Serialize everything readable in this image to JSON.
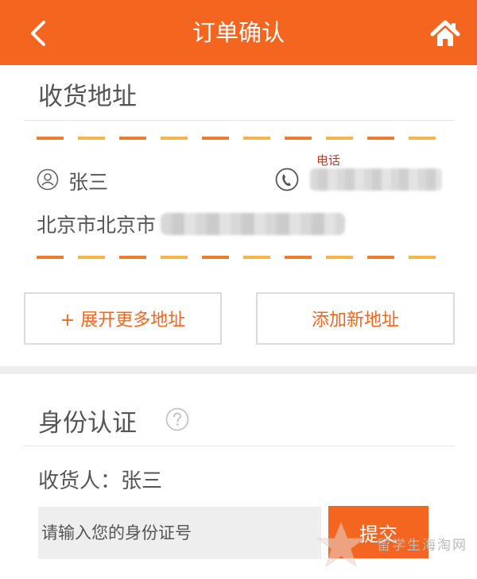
{
  "header": {
    "title": "订单确认",
    "back_icon": "chevron-left-icon",
    "home_icon": "home-icon",
    "background": "#f46620"
  },
  "address_section": {
    "title": "收货地址",
    "recipient": {
      "icon": "user-icon",
      "name": "张三"
    },
    "phone": {
      "icon": "phone-icon",
      "label": "电话"
    },
    "address": {
      "text": "北京市北京市"
    },
    "buttons": {
      "expand_label": "+ 展开更多地址",
      "add_label": "添加新地址"
    }
  },
  "identity_section": {
    "title": "身份认证",
    "help_icon": "question-circle-icon",
    "consignee_label": "收货人：张三",
    "id_input": {
      "placeholder": "请输入您的身份证号",
      "value": ""
    },
    "submit_label": "提交"
  },
  "watermark": {
    "text": "留学生海淘网"
  },
  "colors": {
    "accent": "#f46620",
    "stripe_orange": "#f07b2d",
    "stripe_yellow": "#f6b549",
    "text": "#555555"
  }
}
